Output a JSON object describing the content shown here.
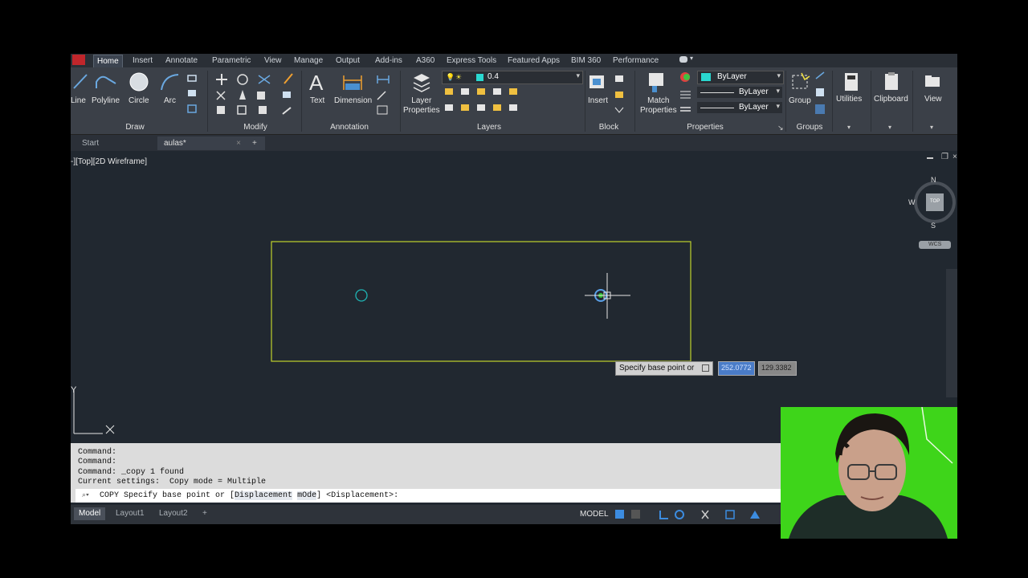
{
  "ribbon_tabs": [
    "Home",
    "Insert",
    "Annotate",
    "Parametric",
    "View",
    "Manage",
    "Output",
    "Add-ins",
    "A360",
    "Express Tools",
    "Featured Apps",
    "BIM 360",
    "Performance"
  ],
  "draw": {
    "line": "Line",
    "polyline": "Polyline",
    "circle": "Circle",
    "arc": "Arc",
    "panel": "Draw"
  },
  "modify": {
    "panel": "Modify"
  },
  "annotation": {
    "text": "Text",
    "dimension": "Dimension",
    "panel": "Annotation"
  },
  "layers": {
    "layer_properties": "Layer\nProperties",
    "current_layer": "0.4",
    "panel": "Layers"
  },
  "block": {
    "insert": "Insert",
    "panel": "Block"
  },
  "properties": {
    "match": "Match\nProperties",
    "color": "ByLayer",
    "linetype": "ByLayer",
    "lineweight": "ByLayer",
    "panel": "Properties"
  },
  "groups": {
    "group": "Group",
    "panel": "Groups"
  },
  "utilities": "Utilities",
  "clipboard": "Clipboard",
  "view": "View",
  "doc_tabs": {
    "start": "Start",
    "current": "aulas*"
  },
  "viewport_label": "-][Top][2D Wireframe]",
  "viewcube": {
    "n": "N",
    "s": "S",
    "w": "W",
    "top": "TOP",
    "wcs": "WCS"
  },
  "cursor_prompt": {
    "text": "Specify base point or",
    "x_value": "252.0772",
    "y_value": "129.3382"
  },
  "axis_y": "Y",
  "command_history": [
    "Command:",
    "Command:",
    "Command: _copy 1 found",
    "Current settings:  Copy mode = Multiple"
  ],
  "command_input": {
    "prefix": "COPY Specify base point or [",
    "opt1": "Displacement",
    "opt2": "mOde",
    "suffix": "] <Displacement>:"
  },
  "layout_tabs": [
    "Model",
    "Layout1",
    "Layout2"
  ],
  "status": {
    "model": "MODEL"
  },
  "colors": {
    "rect_outline": "#c0d32c",
    "circle": "#1fb5b5",
    "ribbon_bg": "#3b4048",
    "viewport_bg": "#212830",
    "webcam_bg": "#3ed51a"
  }
}
